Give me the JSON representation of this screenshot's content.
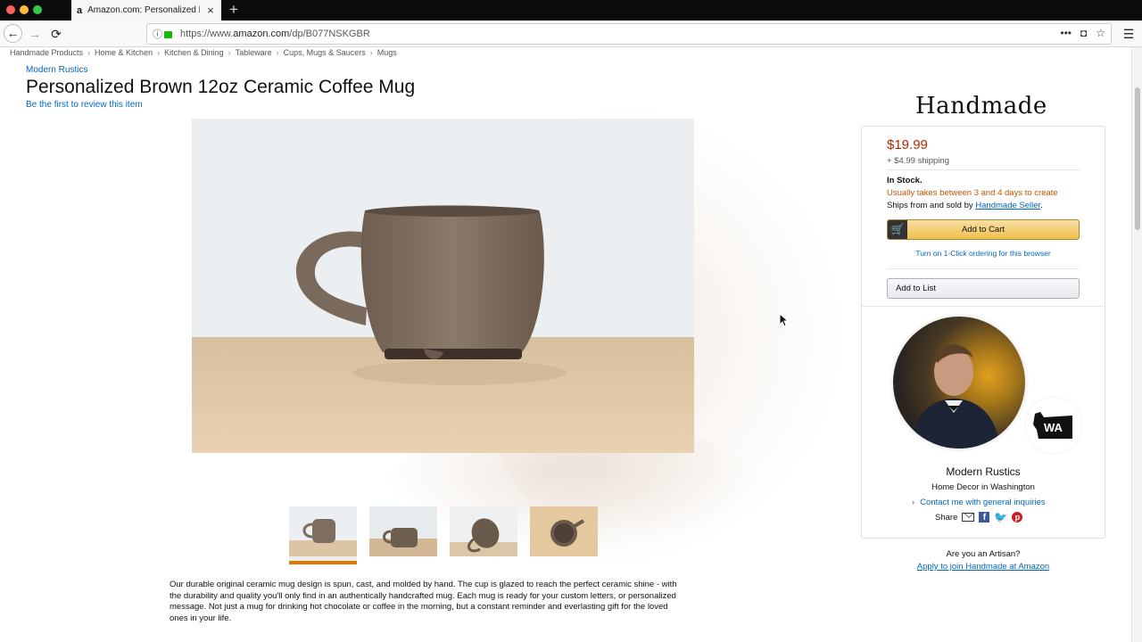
{
  "browser": {
    "tab_title": "Amazon.com: Personalized Bro",
    "url_prefix": "https://www.",
    "url_domain": "amazon.com",
    "url_path": "/dp/B077NSKGBR"
  },
  "breadcrumb": [
    "Handmade Products",
    "Home & Kitchen",
    "Kitchen & Dining",
    "Tableware",
    "Cups, Mugs & Saucers",
    "Mugs"
  ],
  "product": {
    "brand": "Modern Rustics",
    "title": "Personalized Brown 12oz Ceramic Coffee Mug",
    "review_link": "Be the first to review this item",
    "description": "Our durable original ceramic mug design is spun, cast, and molded by hand. The cup is glazed to reach the perfect ceramic shine - with the durability and quality you'll only find in an authentically handcrafted mug. Each mug is ready for your custom letters, or personalized message. Not just a mug for drinking hot chocolate or coffee in the morning, but a constant reminder and everlasting gift for the loved ones in your life.",
    "thumbnail_count": 4,
    "selected_thumbnail": 1
  },
  "buybox": {
    "logo": "Handmade",
    "price": "$19.99",
    "shipping": "+ $4.99 shipping",
    "stock": "In Stock.",
    "lead_time": "Usually takes between 3 and 4 days to create",
    "ships_prefix": "Ships from and sold by ",
    "seller_link": "Handmade Seller",
    "ships_suffix": ".",
    "add_to_cart": "Add to Cart",
    "one_click": "Turn on 1-Click ordering for this browser",
    "add_to_list": "Add to List"
  },
  "seller": {
    "name": "Modern Rustics",
    "location": "Home Decor in Washington",
    "contact": "Contact me with general inquiries",
    "share_label": "Share",
    "state_badge": "WA"
  },
  "artisan": {
    "question": "Are you an Artisan?",
    "join_link": "Apply to join Handmade at Amazon"
  },
  "colors": {
    "link": "#0066c0",
    "price": "#b12704",
    "lead_time": "#c45500",
    "cart_button": "#f0c14b",
    "selected_thumb": "#e77600"
  }
}
